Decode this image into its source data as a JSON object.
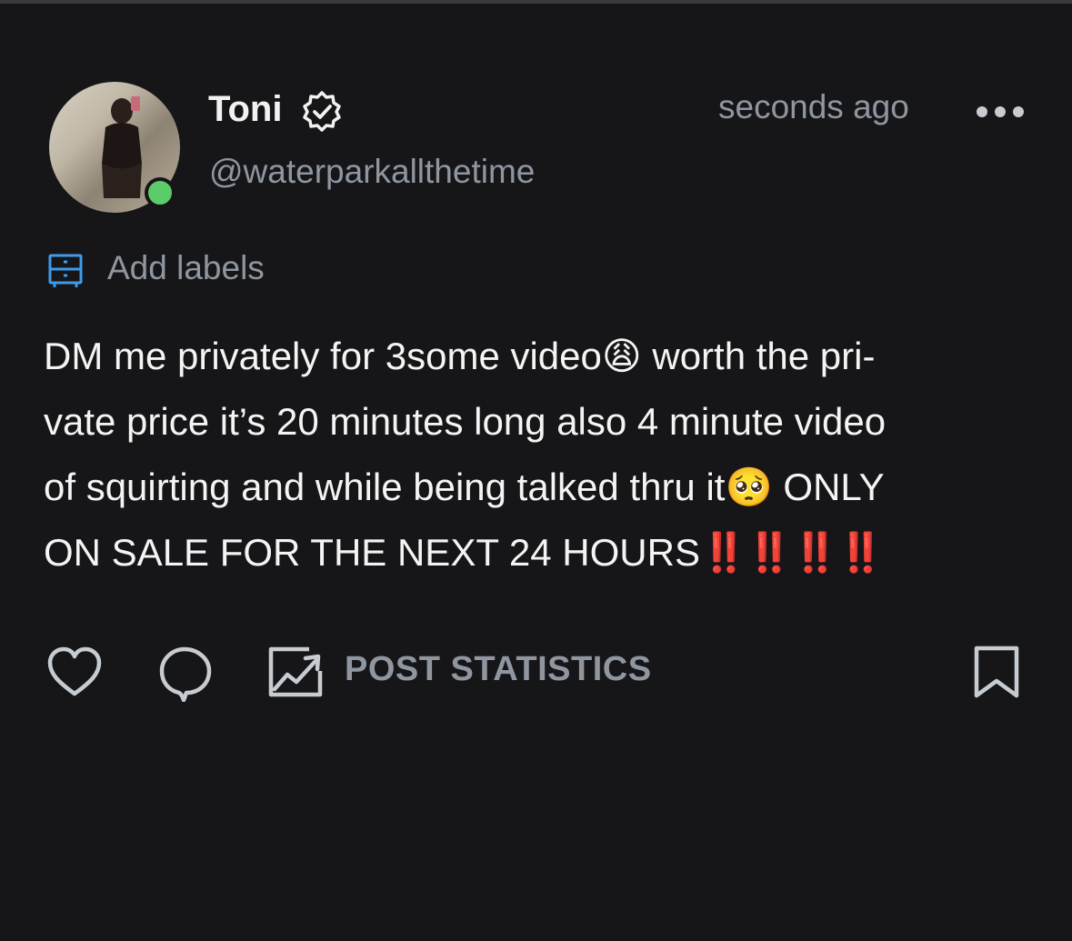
{
  "post": {
    "author": {
      "name": "Toni",
      "handle": "@waterparkallthetime",
      "verified": true,
      "online": true
    },
    "timestamp": "seconds ago",
    "labels_action": "Add labels",
    "text_lines": [
      [
        "DM me privately for 3some video",
        "😩",
        " worth the pri-"
      ],
      [
        "vate price it’s 20 minutes long also 4 minute video"
      ],
      [
        "of squirting and while being talked thru it",
        "🥺",
        " ONLY"
      ],
      [
        "ON SALE FOR THE NEXT 24 HOURS",
        "‼️‼️‼️‼️"
      ]
    ],
    "stats_label": "POST STATISTICS"
  },
  "icons": {
    "verified": "verified-badge-icon",
    "more": "more-dots-icon",
    "labels": "labels-drawer-icon",
    "like": "heart-icon",
    "comment": "comment-bubble-icon",
    "stats": "chart-icon",
    "bookmark": "bookmark-icon"
  },
  "colors": {
    "background": "#161618",
    "text_primary": "#f4f4f4",
    "text_secondary": "#8f96a0",
    "accent_blue": "#3d9be9",
    "online_green": "#5ccb6a",
    "alert_red": "#e0352b"
  }
}
